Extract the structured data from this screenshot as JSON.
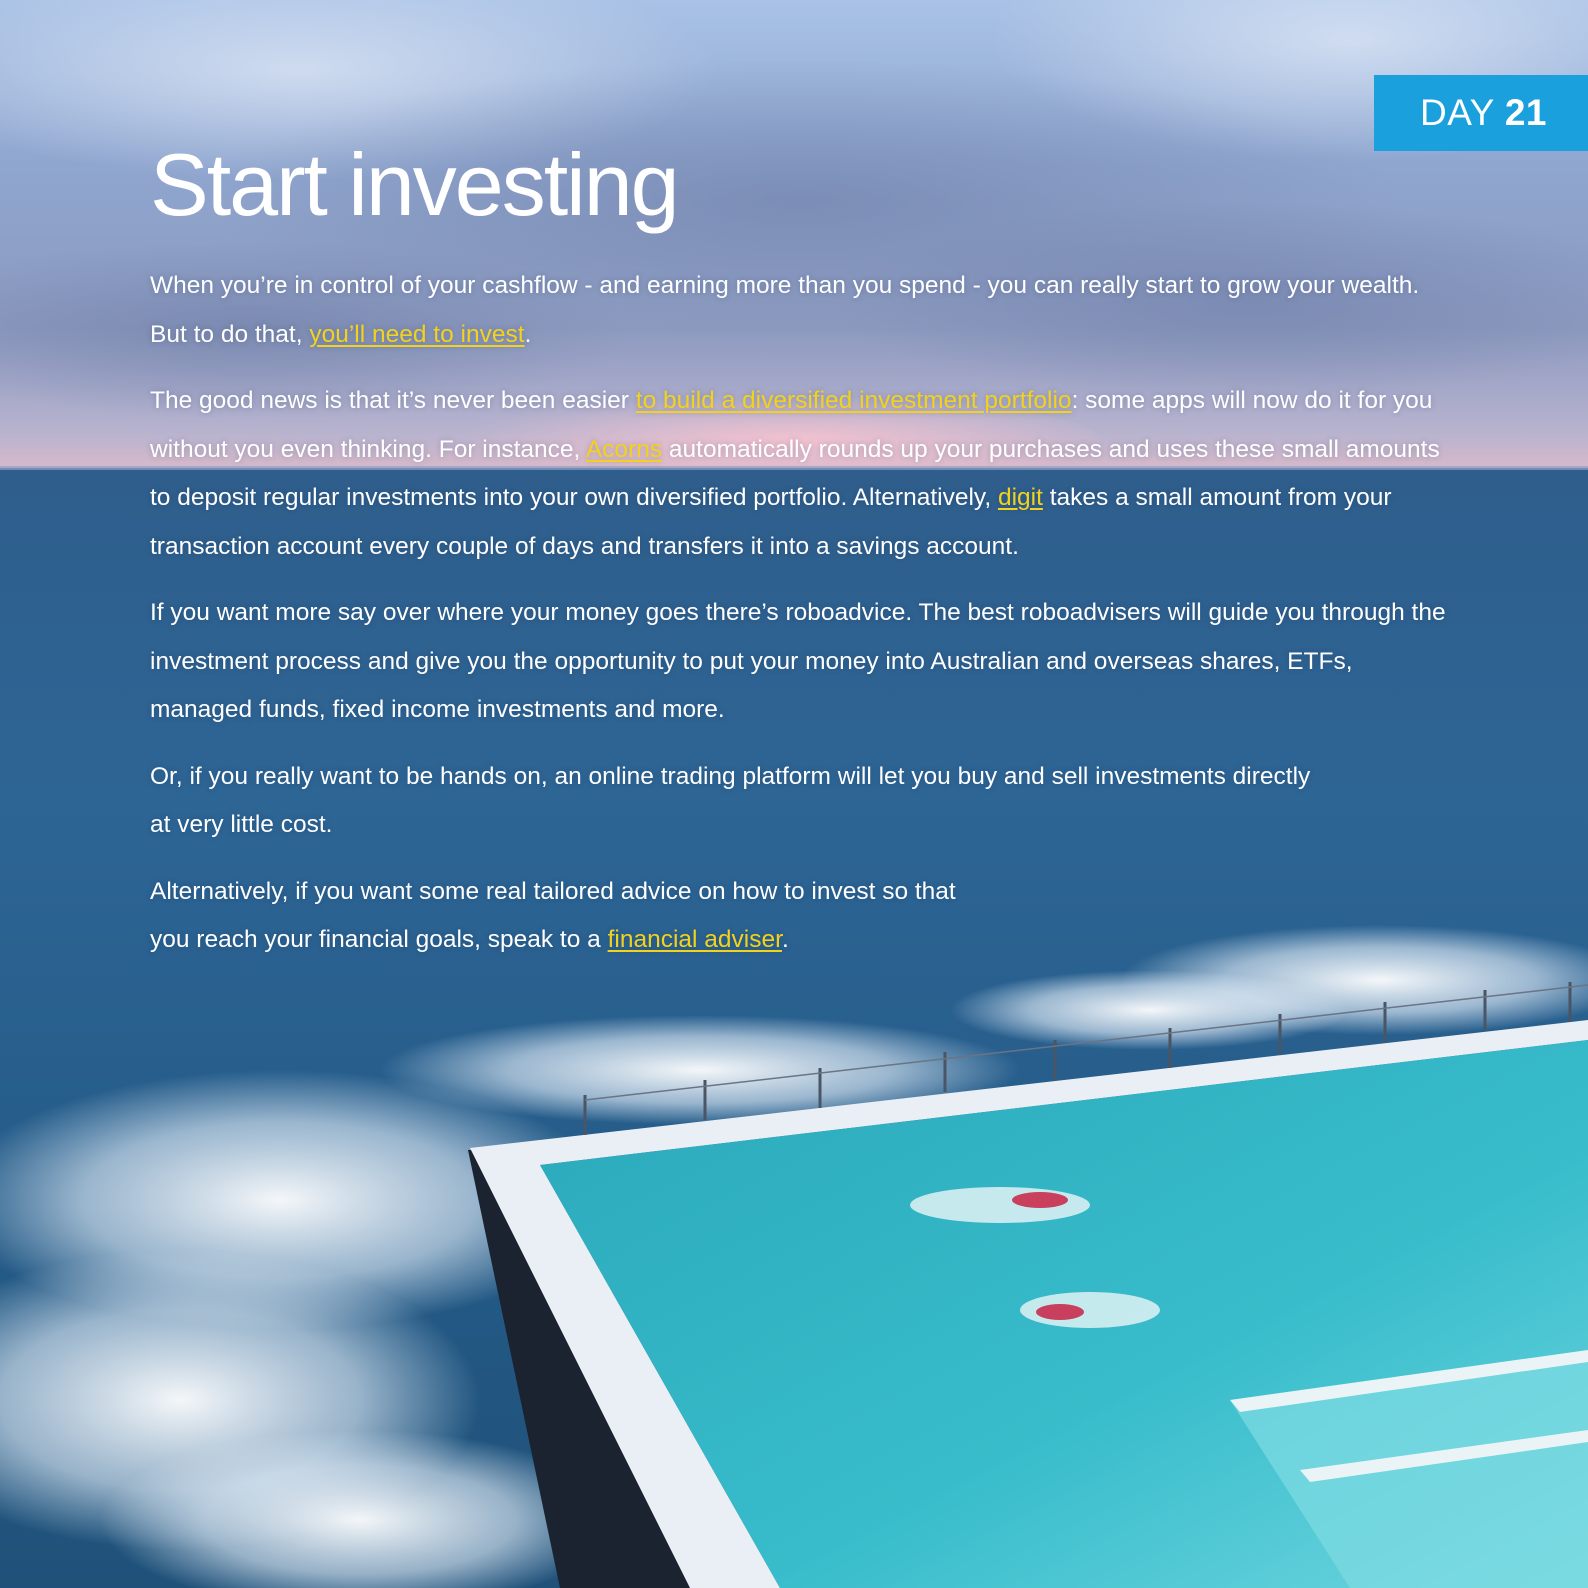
{
  "badge": {
    "day_word": "DAY",
    "day_number": "21",
    "color": "#1aa0dc"
  },
  "title": "Start investing",
  "link_color": "#f2d21c",
  "paragraphs": {
    "p1": {
      "t1": "When you’re in control of your cashflow - and earning more than you spend - you can really start to grow your wealth. But to do that, ",
      "link1": "you’ll need to invest",
      "t2": "."
    },
    "p2": {
      "t1": "The good news is that it’s never been easier ",
      "link1": "to build a diversified investment portfolio",
      "t2": ": some apps will now do it for you without you even thinking. For instance, ",
      "link2": "Acorns",
      "t3": " automatically rounds up your purchases and uses these small amounts to deposit regular investments into your own diversified portfolio. Alternatively, ",
      "link3": "digit",
      "t4": " takes a small amount from your transaction account every couple of days and transfers it into a savings account."
    },
    "p3": {
      "t1": "If you want more say over where your money goes there’s roboadvice. The best roboadvisers will guide you through the investment process and give you the opportunity to put your money into Australian and overseas shares, ETFs, managed funds, fixed income investments and more."
    },
    "p4": {
      "t1": "Or, if you really want to be hands on, an online trading platform will let you buy and sell investments directly",
      "t2": "at very little cost."
    },
    "p5": {
      "t1": "Alternatively, if you want some real tailored advice on how to invest so that",
      "t2": "you reach your financial goals, speak to a ",
      "link1": "financial adviser",
      "t3": "."
    }
  }
}
